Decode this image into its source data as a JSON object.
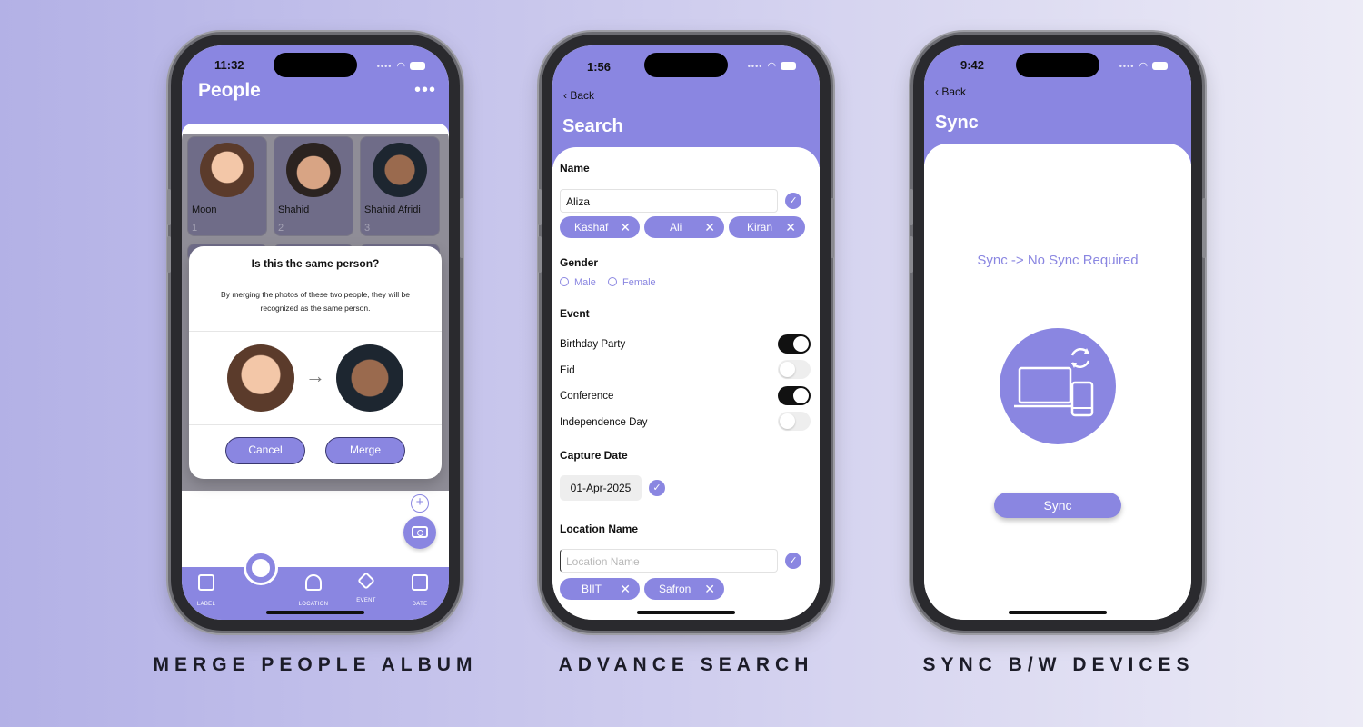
{
  "captions": [
    "MERGE PEOPLE ALBUM",
    "ADVANCE SEARCH",
    "SYNC B/W DEVICES"
  ],
  "phone1": {
    "time": "11:32",
    "title": "People",
    "more": "•••",
    "people": [
      {
        "name": "Moon",
        "count": "1"
      },
      {
        "name": "Shahid",
        "count": "2"
      },
      {
        "name": "Shahid Afridi",
        "count": "3"
      }
    ],
    "dialog": {
      "title": "Is this the same person?",
      "message": "By merging the photos of these two people, they will be recognized as the same person.",
      "arrow": "→",
      "cancel": "Cancel",
      "merge": "Merge"
    },
    "add": "+",
    "tabs": [
      "LABEL",
      "LOCATION",
      "EVENT",
      "DATE"
    ]
  },
  "phone2": {
    "time": "1:56",
    "back": "Back",
    "title": "Search",
    "name_label": "Name",
    "name_value": "Aliza",
    "name_chips": [
      "Kashaf",
      "Ali",
      "Kiran"
    ],
    "gender_label": "Gender",
    "gender_options": [
      "Male",
      "Female"
    ],
    "event_label": "Event",
    "events": [
      {
        "name": "Birthday Party",
        "on": true
      },
      {
        "name": "Eid",
        "on": false
      },
      {
        "name": "Conference",
        "on": true
      },
      {
        "name": "Independence Day",
        "on": false
      }
    ],
    "capture_label": "Capture Date",
    "capture_date": "01-Apr-2025",
    "location_label": "Location Name",
    "location_placeholder": "Location Name",
    "location_chips": [
      "BIIT",
      "Safron"
    ],
    "check": "✓",
    "chip_x": "✕"
  },
  "phone3": {
    "time": "9:42",
    "back": "Back",
    "title": "Sync",
    "status": "Sync ->  No Sync Required",
    "button": "Sync"
  },
  "colors": {
    "accent": "#8a86e1",
    "frame": "#2a2a2e"
  }
}
